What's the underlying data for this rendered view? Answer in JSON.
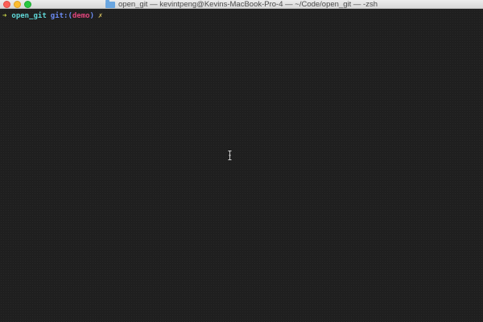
{
  "window": {
    "title": "open_git — kevintpeng@Kevins-MacBook-Pro-4 — ~/Code/open_git — -zsh"
  },
  "terminal": {
    "prompt": {
      "arrow": "➜",
      "directory": "open_git",
      "git_label": "git:",
      "paren_open": "(",
      "branch": "demo",
      "paren_close": ")",
      "dirty_marker": "✗"
    }
  },
  "icons": {
    "title_icon": "folder-icon",
    "cursor": "text-ibeam-cursor-icon"
  },
  "colors": {
    "background": "#1f1f1f",
    "arrow": "#c8d34a",
    "directory": "#5fd7d7",
    "git": "#6c8cf5",
    "branch": "#e0457b",
    "dirty": "#d7c25f"
  }
}
